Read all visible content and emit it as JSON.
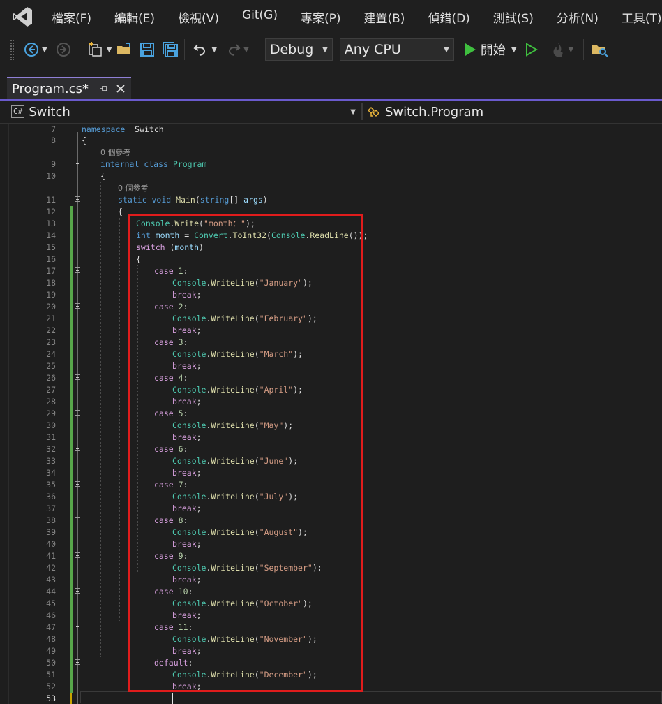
{
  "menu": [
    "檔案(F)",
    "編輯(E)",
    "檢視(V)",
    "Git(G)",
    "專案(P)",
    "建置(B)",
    "偵錯(D)",
    "測試(S)",
    "分析(N)",
    "工具(T)"
  ],
  "toolbar": {
    "configuration": "Debug",
    "platform": "Any CPU",
    "start_label": "開始",
    "icons": [
      "back-icon",
      "forward-icon",
      "new-project-icon",
      "open-folder-icon",
      "save-icon",
      "save-all-icon",
      "undo-icon",
      "redo-icon",
      "start-icon",
      "start-without-debugging-icon",
      "hot-reload-icon",
      "solution-explorer-icon"
    ]
  },
  "tab": {
    "title": "Program.cs*"
  },
  "nav": {
    "project": "Switch",
    "project_badge": "C#",
    "class": "Switch.Program"
  },
  "colors": {
    "accent": "#6a5acd",
    "highlight_box": "#e11c1c",
    "change_bar": "#57a64a",
    "keyword": "#569cd6",
    "type": "#4ec9b0",
    "method": "#dcdcaa",
    "string": "#d69d85",
    "control": "#d8a0df"
  },
  "editor": {
    "references": "0 個參考",
    "lines": [
      {
        "n": "7",
        "tokens": [
          [
            "kw",
            "namespace"
          ],
          [
            "",
            "  Switch"
          ]
        ]
      },
      {
        "n": "8",
        "tokens": [
          [
            "",
            "{"
          ]
        ]
      },
      {
        "n": "9",
        "tokens": [
          [
            "kw",
            "internal"
          ],
          [
            "",
            " "
          ],
          [
            "kw",
            "class"
          ],
          [
            "",
            " "
          ],
          [
            "ty",
            "Program"
          ]
        ]
      },
      {
        "n": "10",
        "tokens": [
          [
            "",
            "{"
          ]
        ]
      },
      {
        "n": "11",
        "tokens": [
          [
            "kw",
            "static"
          ],
          [
            "",
            " "
          ],
          [
            "kw",
            "void"
          ],
          [
            "",
            " "
          ],
          [
            "fn",
            "Main"
          ],
          [
            "",
            "("
          ],
          [
            "kw",
            "string"
          ],
          [
            "",
            "[] "
          ],
          [
            "pm",
            "args"
          ],
          [
            "",
            ")"
          ]
        ]
      },
      {
        "n": "12",
        "tokens": [
          [
            "",
            "{"
          ]
        ]
      },
      {
        "n": "13",
        "tokens": [
          [
            "ty",
            "Console"
          ],
          [
            "",
            "."
          ],
          [
            "fn",
            "Write"
          ],
          [
            "",
            "("
          ],
          [
            "st",
            "\"month：\""
          ],
          [
            "",
            ");"
          ]
        ]
      },
      {
        "n": "14",
        "tokens": [
          [
            "kw",
            "int"
          ],
          [
            "",
            " "
          ],
          [
            "pm",
            "month"
          ],
          [
            "",
            " = "
          ],
          [
            "ty",
            "Convert"
          ],
          [
            "",
            "."
          ],
          [
            "fn",
            "ToInt32"
          ],
          [
            "",
            "("
          ],
          [
            "ty",
            "Console"
          ],
          [
            "",
            "."
          ],
          [
            "fn",
            "ReadLine"
          ],
          [
            "",
            "());"
          ]
        ]
      },
      {
        "n": "15",
        "tokens": [
          [
            "ctl",
            "switch"
          ],
          [
            "",
            " ("
          ],
          [
            "pm",
            "month"
          ],
          [
            "",
            ")"
          ]
        ]
      },
      {
        "n": "16",
        "tokens": [
          [
            "",
            "{"
          ]
        ]
      },
      {
        "n": "17",
        "tokens": [
          [
            "ctl",
            "case"
          ],
          [
            "",
            " "
          ],
          [
            "nm",
            "1"
          ],
          [
            "",
            ":"
          ]
        ]
      },
      {
        "n": "18",
        "tokens": [
          [
            "ty",
            "Console"
          ],
          [
            "",
            "."
          ],
          [
            "fn",
            "WriteLine"
          ],
          [
            "",
            "("
          ],
          [
            "st",
            "\"January\""
          ],
          [
            "",
            ");"
          ]
        ]
      },
      {
        "n": "19",
        "tokens": [
          [
            "ctl",
            "break"
          ],
          [
            "",
            ";"
          ]
        ]
      },
      {
        "n": "20",
        "tokens": [
          [
            "ctl",
            "case"
          ],
          [
            "",
            " "
          ],
          [
            "nm",
            "2"
          ],
          [
            "",
            ":"
          ]
        ]
      },
      {
        "n": "21",
        "tokens": [
          [
            "ty",
            "Console"
          ],
          [
            "",
            "."
          ],
          [
            "fn",
            "WriteLine"
          ],
          [
            "",
            "("
          ],
          [
            "st",
            "\"February\""
          ],
          [
            "",
            ");"
          ]
        ]
      },
      {
        "n": "22",
        "tokens": [
          [
            "ctl",
            "break"
          ],
          [
            "",
            ";"
          ]
        ]
      },
      {
        "n": "23",
        "tokens": [
          [
            "ctl",
            "case"
          ],
          [
            "",
            " "
          ],
          [
            "nm",
            "3"
          ],
          [
            "",
            ":"
          ]
        ]
      },
      {
        "n": "24",
        "tokens": [
          [
            "ty",
            "Console"
          ],
          [
            "",
            "."
          ],
          [
            "fn",
            "WriteLine"
          ],
          [
            "",
            "("
          ],
          [
            "st",
            "\"March\""
          ],
          [
            "",
            ");"
          ]
        ]
      },
      {
        "n": "25",
        "tokens": [
          [
            "ctl",
            "break"
          ],
          [
            "",
            ";"
          ]
        ]
      },
      {
        "n": "26",
        "tokens": [
          [
            "ctl",
            "case"
          ],
          [
            "",
            " "
          ],
          [
            "nm",
            "4"
          ],
          [
            "",
            ":"
          ]
        ]
      },
      {
        "n": "27",
        "tokens": [
          [
            "ty",
            "Console"
          ],
          [
            "",
            "."
          ],
          [
            "fn",
            "WriteLine"
          ],
          [
            "",
            "("
          ],
          [
            "st",
            "\"April\""
          ],
          [
            "",
            ");"
          ]
        ]
      },
      {
        "n": "28",
        "tokens": [
          [
            "ctl",
            "break"
          ],
          [
            "",
            ";"
          ]
        ]
      },
      {
        "n": "29",
        "tokens": [
          [
            "ctl",
            "case"
          ],
          [
            "",
            " "
          ],
          [
            "nm",
            "5"
          ],
          [
            "",
            ":"
          ]
        ]
      },
      {
        "n": "30",
        "tokens": [
          [
            "ty",
            "Console"
          ],
          [
            "",
            "."
          ],
          [
            "fn",
            "WriteLine"
          ],
          [
            "",
            "("
          ],
          [
            "st",
            "\"May\""
          ],
          [
            "",
            ");"
          ]
        ]
      },
      {
        "n": "31",
        "tokens": [
          [
            "ctl",
            "break"
          ],
          [
            "",
            ";"
          ]
        ]
      },
      {
        "n": "32",
        "tokens": [
          [
            "ctl",
            "case"
          ],
          [
            "",
            " "
          ],
          [
            "nm",
            "6"
          ],
          [
            "",
            ":"
          ]
        ]
      },
      {
        "n": "33",
        "tokens": [
          [
            "ty",
            "Console"
          ],
          [
            "",
            "."
          ],
          [
            "fn",
            "WriteLine"
          ],
          [
            "",
            "("
          ],
          [
            "st",
            "\"June\""
          ],
          [
            "",
            ");"
          ]
        ]
      },
      {
        "n": "34",
        "tokens": [
          [
            "ctl",
            "break"
          ],
          [
            "",
            ";"
          ]
        ]
      },
      {
        "n": "35",
        "tokens": [
          [
            "ctl",
            "case"
          ],
          [
            "",
            " "
          ],
          [
            "nm",
            "7"
          ],
          [
            "",
            ":"
          ]
        ]
      },
      {
        "n": "36",
        "tokens": [
          [
            "ty",
            "Console"
          ],
          [
            "",
            "."
          ],
          [
            "fn",
            "WriteLine"
          ],
          [
            "",
            "("
          ],
          [
            "st",
            "\"July\""
          ],
          [
            "",
            ");"
          ]
        ]
      },
      {
        "n": "37",
        "tokens": [
          [
            "ctl",
            "break"
          ],
          [
            "",
            ";"
          ]
        ]
      },
      {
        "n": "38",
        "tokens": [
          [
            "ctl",
            "case"
          ],
          [
            "",
            " "
          ],
          [
            "nm",
            "8"
          ],
          [
            "",
            ":"
          ]
        ]
      },
      {
        "n": "39",
        "tokens": [
          [
            "ty",
            "Console"
          ],
          [
            "",
            "."
          ],
          [
            "fn",
            "WriteLine"
          ],
          [
            "",
            "("
          ],
          [
            "st",
            "\"August\""
          ],
          [
            "",
            ");"
          ]
        ]
      },
      {
        "n": "40",
        "tokens": [
          [
            "ctl",
            "break"
          ],
          [
            "",
            ";"
          ]
        ]
      },
      {
        "n": "41",
        "tokens": [
          [
            "ctl",
            "case"
          ],
          [
            "",
            " "
          ],
          [
            "nm",
            "9"
          ],
          [
            "",
            ":"
          ]
        ]
      },
      {
        "n": "42",
        "tokens": [
          [
            "ty",
            "Console"
          ],
          [
            "",
            "."
          ],
          [
            "fn",
            "WriteLine"
          ],
          [
            "",
            "("
          ],
          [
            "st",
            "\"September\""
          ],
          [
            "",
            ");"
          ]
        ]
      },
      {
        "n": "43",
        "tokens": [
          [
            "ctl",
            "break"
          ],
          [
            "",
            ";"
          ]
        ]
      },
      {
        "n": "44",
        "tokens": [
          [
            "ctl",
            "case"
          ],
          [
            "",
            " "
          ],
          [
            "nm",
            "10"
          ],
          [
            "",
            ":"
          ]
        ]
      },
      {
        "n": "45",
        "tokens": [
          [
            "ty",
            "Console"
          ],
          [
            "",
            "."
          ],
          [
            "fn",
            "WriteLine"
          ],
          [
            "",
            "("
          ],
          [
            "st",
            "\"October\""
          ],
          [
            "",
            ");"
          ]
        ]
      },
      {
        "n": "46",
        "tokens": [
          [
            "ctl",
            "break"
          ],
          [
            "",
            ";"
          ]
        ]
      },
      {
        "n": "47",
        "tokens": [
          [
            "ctl",
            "case"
          ],
          [
            "",
            " "
          ],
          [
            "nm",
            "11"
          ],
          [
            "",
            ":"
          ]
        ]
      },
      {
        "n": "48",
        "tokens": [
          [
            "ty",
            "Console"
          ],
          [
            "",
            "."
          ],
          [
            "fn",
            "WriteLine"
          ],
          [
            "",
            "("
          ],
          [
            "st",
            "\"November\""
          ],
          [
            "",
            ");"
          ]
        ]
      },
      {
        "n": "49",
        "tokens": [
          [
            "ctl",
            "break"
          ],
          [
            "",
            ";"
          ]
        ]
      },
      {
        "n": "50",
        "tokens": [
          [
            "ctl",
            "default"
          ],
          [
            "",
            ":"
          ]
        ]
      },
      {
        "n": "51",
        "tokens": [
          [
            "ty",
            "Console"
          ],
          [
            "",
            "."
          ],
          [
            "fn",
            "WriteLine"
          ],
          [
            "",
            "("
          ],
          [
            "st",
            "\"December\""
          ],
          [
            "",
            ");"
          ]
        ]
      },
      {
        "n": "52",
        "tokens": [
          [
            "ctl",
            "break"
          ],
          [
            "",
            ";"
          ]
        ]
      },
      {
        "n": "53",
        "tokens": []
      }
    ]
  }
}
